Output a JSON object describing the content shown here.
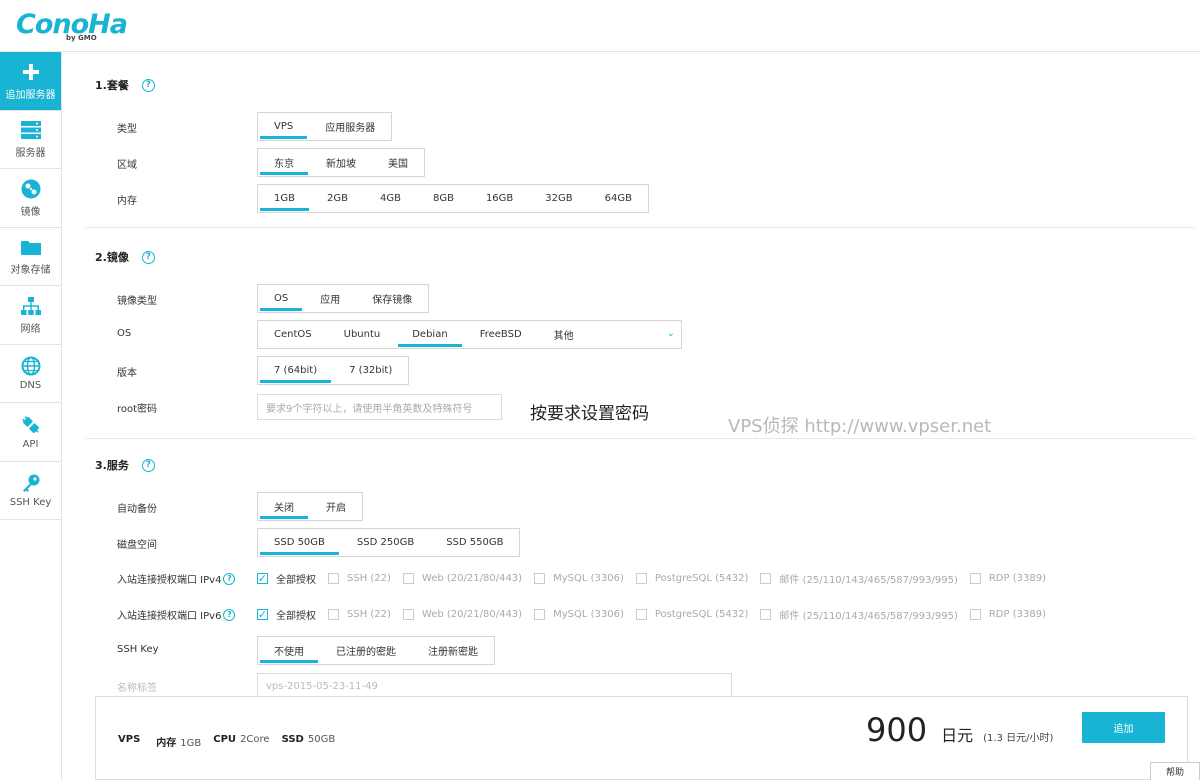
{
  "brand": {
    "logo_text": "ConoHa",
    "logo_sub": "by GMO",
    "accent": "#19b3d4"
  },
  "sidebar": {
    "items": [
      {
        "label": "追加服务器",
        "icon": "plus-icon"
      },
      {
        "label": "服务器",
        "icon": "server-icon"
      },
      {
        "label": "镜像",
        "icon": "image-disc-icon"
      },
      {
        "label": "对象存储",
        "icon": "folder-icon"
      },
      {
        "label": "网络",
        "icon": "network-icon"
      },
      {
        "label": "DNS",
        "icon": "globe-icon"
      },
      {
        "label": "API",
        "icon": "api-icon"
      },
      {
        "label": "SSH Key",
        "icon": "key-icon"
      }
    ]
  },
  "sections": {
    "plan": {
      "title": "1.套餐",
      "type": {
        "label": "类型",
        "options": [
          "VPS",
          "应用服务器"
        ],
        "selected": 0
      },
      "region": {
        "label": "区域",
        "options": [
          "东京",
          "新加坡",
          "美国"
        ],
        "selected": 0
      },
      "memory": {
        "label": "内存",
        "options": [
          "1GB",
          "2GB",
          "4GB",
          "8GB",
          "16GB",
          "32GB",
          "64GB"
        ],
        "selected": 0
      }
    },
    "image": {
      "title": "2.镜像",
      "image_type": {
        "label": "镜像类型",
        "options": [
          "OS",
          "应用",
          "保存镜像"
        ],
        "selected": 0
      },
      "os": {
        "label": "OS",
        "options": [
          "CentOS",
          "Ubuntu",
          "Debian",
          "FreeBSD",
          "其他"
        ],
        "selected": 2
      },
      "version": {
        "label": "版本",
        "options": [
          "7 (64bit)",
          "7 (32bit)"
        ],
        "selected": 0
      },
      "root_password": {
        "label": "root密码",
        "placeholder": "要求9个字符以上，请使用半角英数及特殊符号"
      }
    },
    "service": {
      "title": "3.服务",
      "backup": {
        "label": "自动备份",
        "options": [
          "关闭",
          "开启"
        ],
        "selected": 0
      },
      "disk": {
        "label": "磁盘空间",
        "options": [
          "SSD 50GB",
          "SSD 250GB",
          "SSD 550GB"
        ],
        "selected": 0
      },
      "ipv4": {
        "label": "入站连接授权端口 IPv4"
      },
      "ipv6": {
        "label": "入站连接授权端口 IPv6"
      },
      "ports": [
        "全部授权",
        "SSH (22)",
        "Web (20/21/80/443)",
        "MySQL (3306)",
        "PostgreSQL (5432)",
        "邮件 (25/110/143/465/587/993/995)",
        "RDP (3389)"
      ],
      "ssh_key": {
        "label": "SSH Key",
        "options": [
          "不使用",
          "已注册的密匙",
          "注册新密匙"
        ],
        "selected": 0
      },
      "name_tag": {
        "label": "名称标签",
        "value": "vps-2015-05-23-11-49"
      }
    }
  },
  "annotation": "按要求设置密码",
  "watermark": "VPS侦探 http://www.vpser.net",
  "summary": {
    "vps": "VPS",
    "mem_label": "内存",
    "mem_value": "1GB",
    "cpu_label": "CPU",
    "cpu_value": "2Core",
    "ssd_label": "SSD",
    "ssd_value": "50GB",
    "price": "900",
    "currency": "日元",
    "hourly": "(1.3 日元/小时)",
    "add_button": "追加"
  },
  "help_tab": "帮助"
}
